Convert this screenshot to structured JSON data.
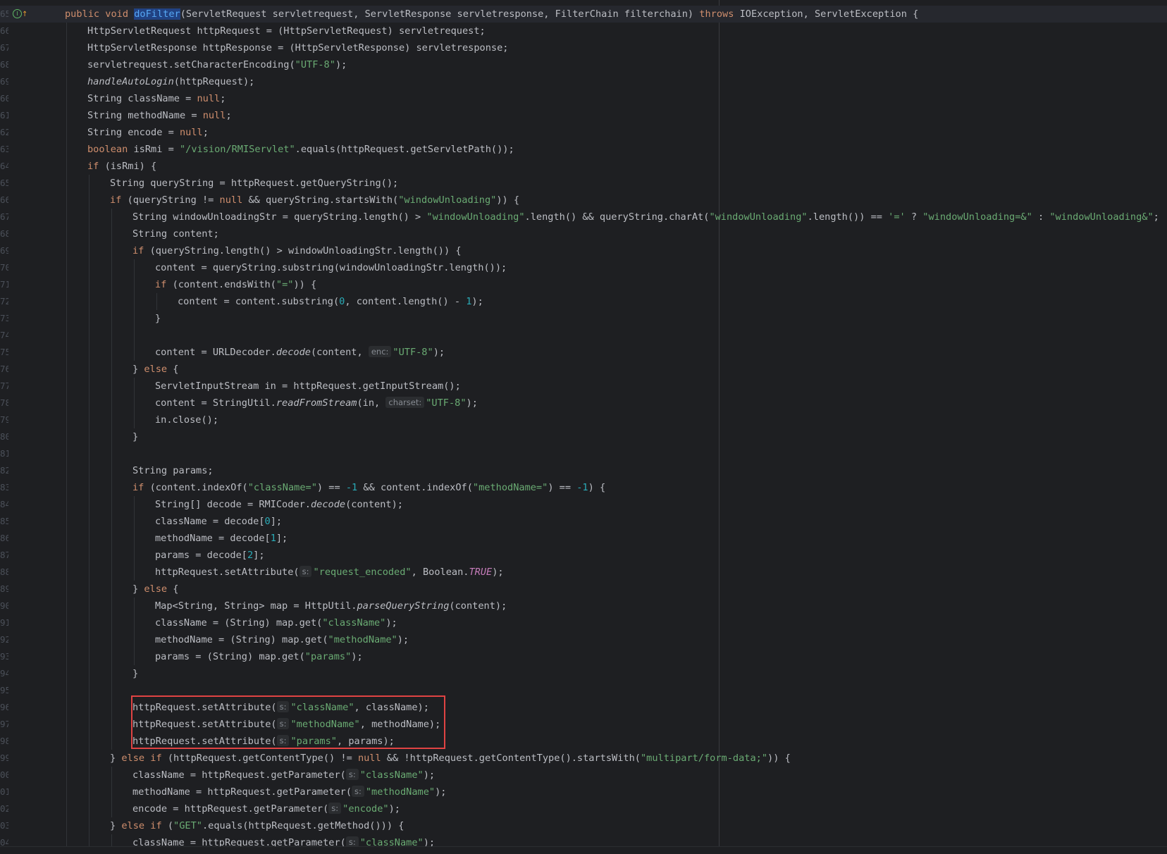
{
  "editor": {
    "annotation_icon": "implements-method-icon",
    "lines": [
      {
        "n": "65",
        "indent": 0,
        "current": true,
        "icon": true,
        "tokens": [
          [
            "kw",
            "public void "
          ],
          [
            "hl",
            "doFilter"
          ],
          [
            "p",
            "(ServletRequest servletrequest, ServletResponse servletresponse, FilterChain filterchain) "
          ],
          [
            "kw",
            "throws "
          ],
          [
            "p",
            "IOException, ServletException {"
          ]
        ]
      },
      {
        "n": "66",
        "indent": 1,
        "tokens": [
          [
            "p",
            "HttpServletRequest httpRequest = (HttpServletRequest) servletrequest;"
          ]
        ]
      },
      {
        "n": "67",
        "indent": 1,
        "tokens": [
          [
            "p",
            "HttpServletResponse httpResponse = (HttpServletResponse) servletresponse;"
          ]
        ]
      },
      {
        "n": "68",
        "indent": 1,
        "tokens": [
          [
            "p",
            "servletrequest.setCharacterEncoding("
          ],
          [
            "str",
            "\"UTF-8\""
          ],
          [
            "p",
            ");"
          ]
        ]
      },
      {
        "n": "69",
        "indent": 1,
        "tokens": [
          [
            "it",
            "handleAutoLogin"
          ],
          [
            "p",
            "(httpRequest);"
          ]
        ]
      },
      {
        "n": "60",
        "indent": 1,
        "tokens": [
          [
            "p",
            "String className = "
          ],
          [
            "kw",
            "null"
          ],
          [
            "p",
            ";"
          ]
        ]
      },
      {
        "n": "61",
        "indent": 1,
        "tokens": [
          [
            "p",
            "String methodName = "
          ],
          [
            "kw",
            "null"
          ],
          [
            "p",
            ";"
          ]
        ]
      },
      {
        "n": "62",
        "indent": 1,
        "tokens": [
          [
            "p",
            "String encode = "
          ],
          [
            "kw",
            "null"
          ],
          [
            "p",
            ";"
          ]
        ]
      },
      {
        "n": "63",
        "indent": 1,
        "tokens": [
          [
            "kw",
            "boolean "
          ],
          [
            "p",
            "isRmi = "
          ],
          [
            "str",
            "\"/vision/RMIServlet\""
          ],
          [
            "p",
            ".equals(httpRequest.getServletPath());"
          ]
        ]
      },
      {
        "n": "64",
        "indent": 1,
        "tokens": [
          [
            "kw",
            "if "
          ],
          [
            "p",
            "(isRmi) {"
          ]
        ]
      },
      {
        "n": "65",
        "indent": 2,
        "tokens": [
          [
            "p",
            "String queryString = httpRequest.getQueryString();"
          ]
        ]
      },
      {
        "n": "66",
        "indent": 2,
        "tokens": [
          [
            "kw",
            "if "
          ],
          [
            "p",
            "(queryString != "
          ],
          [
            "kw",
            "null "
          ],
          [
            "p",
            "&& queryString.startsWith("
          ],
          [
            "str",
            "\"windowUnloading\""
          ],
          [
            "p",
            ")) {"
          ]
        ]
      },
      {
        "n": "67",
        "indent": 3,
        "tokens": [
          [
            "p",
            "String windowUnloadingStr = queryString.length() > "
          ],
          [
            "str",
            "\"windowUnloading\""
          ],
          [
            "p",
            ".length() && queryString.charAt("
          ],
          [
            "str",
            "\"windowUnloading\""
          ],
          [
            "p",
            ".length()) == "
          ],
          [
            "str",
            "'='"
          ],
          [
            "p",
            " ? "
          ],
          [
            "str",
            "\"windowUnloading=&\""
          ],
          [
            "p",
            " : "
          ],
          [
            "str",
            "\"windowUnloading&\""
          ],
          [
            "p",
            ";"
          ]
        ]
      },
      {
        "n": "68",
        "indent": 3,
        "tokens": [
          [
            "p",
            "String content;"
          ]
        ]
      },
      {
        "n": "69",
        "indent": 3,
        "tokens": [
          [
            "kw",
            "if "
          ],
          [
            "p",
            "(queryString.length() > windowUnloadingStr.length()) {"
          ]
        ]
      },
      {
        "n": "70",
        "indent": 4,
        "tokens": [
          [
            "p",
            "content = queryString.substring(windowUnloadingStr.length());"
          ]
        ]
      },
      {
        "n": "71",
        "indent": 4,
        "tokens": [
          [
            "kw",
            "if "
          ],
          [
            "p",
            "(content.endsWith("
          ],
          [
            "str",
            "\"=\""
          ],
          [
            "p",
            ")) {"
          ]
        ]
      },
      {
        "n": "72",
        "indent": 5,
        "tokens": [
          [
            "p",
            "content = content.substring("
          ],
          [
            "num",
            "0"
          ],
          [
            "p",
            ", content.length() - "
          ],
          [
            "num",
            "1"
          ],
          [
            "p",
            ");"
          ]
        ]
      },
      {
        "n": "73",
        "indent": 4,
        "tokens": [
          [
            "p",
            "}"
          ]
        ]
      },
      {
        "n": "74",
        "indent": 4,
        "tokens": []
      },
      {
        "n": "75",
        "indent": 4,
        "tokens": [
          [
            "p",
            "content = URLDecoder."
          ],
          [
            "it",
            "decode"
          ],
          [
            "p",
            "(content, "
          ],
          [
            "hint",
            "enc:"
          ],
          [
            "str",
            "\"UTF-8\""
          ],
          [
            "p",
            ");"
          ]
        ]
      },
      {
        "n": "76",
        "indent": 3,
        "tokens": [
          [
            "p",
            "} "
          ],
          [
            "kw",
            "else "
          ],
          [
            "p",
            "{"
          ]
        ]
      },
      {
        "n": "77",
        "indent": 4,
        "tokens": [
          [
            "p",
            "ServletInputStream in = httpRequest.getInputStream();"
          ]
        ]
      },
      {
        "n": "78",
        "indent": 4,
        "tokens": [
          [
            "p",
            "content = StringUtil."
          ],
          [
            "it",
            "readFromStream"
          ],
          [
            "p",
            "(in, "
          ],
          [
            "hint",
            "charset:"
          ],
          [
            "str",
            "\"UTF-8\""
          ],
          [
            "p",
            ");"
          ]
        ]
      },
      {
        "n": "79",
        "indent": 4,
        "tokens": [
          [
            "p",
            "in.close();"
          ]
        ]
      },
      {
        "n": "80",
        "indent": 3,
        "tokens": [
          [
            "p",
            "}"
          ]
        ]
      },
      {
        "n": "81",
        "indent": 3,
        "tokens": []
      },
      {
        "n": "82",
        "indent": 3,
        "tokens": [
          [
            "p",
            "String params;"
          ]
        ]
      },
      {
        "n": "83",
        "indent": 3,
        "tokens": [
          [
            "kw",
            "if "
          ],
          [
            "p",
            "(content.indexOf("
          ],
          [
            "str",
            "\"className=\""
          ],
          [
            "p",
            ") == "
          ],
          [
            "num",
            "-1"
          ],
          [
            "p",
            " && content.indexOf("
          ],
          [
            "str",
            "\"methodName=\""
          ],
          [
            "p",
            ") == "
          ],
          [
            "num",
            "-1"
          ],
          [
            "p",
            ") {"
          ]
        ]
      },
      {
        "n": "84",
        "indent": 4,
        "tokens": [
          [
            "p",
            "String[] decode = RMICoder."
          ],
          [
            "it",
            "decode"
          ],
          [
            "p",
            "(content);"
          ]
        ]
      },
      {
        "n": "85",
        "indent": 4,
        "tokens": [
          [
            "p",
            "className = decode["
          ],
          [
            "num",
            "0"
          ],
          [
            "p",
            "];"
          ]
        ]
      },
      {
        "n": "86",
        "indent": 4,
        "tokens": [
          [
            "p",
            "methodName = decode["
          ],
          [
            "num",
            "1"
          ],
          [
            "p",
            "];"
          ]
        ]
      },
      {
        "n": "87",
        "indent": 4,
        "tokens": [
          [
            "p",
            "params = decode["
          ],
          [
            "num",
            "2"
          ],
          [
            "p",
            "];"
          ]
        ]
      },
      {
        "n": "88",
        "indent": 4,
        "tokens": [
          [
            "p",
            "httpRequest.setAttribute("
          ],
          [
            "hint",
            "s:"
          ],
          [
            "str",
            "\"request_encoded\""
          ],
          [
            "p",
            ", Boolean."
          ],
          [
            "const",
            "TRUE"
          ],
          [
            "p",
            ");"
          ]
        ]
      },
      {
        "n": "89",
        "indent": 3,
        "tokens": [
          [
            "p",
            "} "
          ],
          [
            "kw",
            "else "
          ],
          [
            "p",
            "{"
          ]
        ]
      },
      {
        "n": "90",
        "indent": 4,
        "tokens": [
          [
            "p",
            "Map<String, String> map = HttpUtil."
          ],
          [
            "it",
            "parseQueryString"
          ],
          [
            "p",
            "(content);"
          ]
        ]
      },
      {
        "n": "91",
        "indent": 4,
        "tokens": [
          [
            "p",
            "className = (String) map.get("
          ],
          [
            "str",
            "\"className\""
          ],
          [
            "p",
            ");"
          ]
        ]
      },
      {
        "n": "92",
        "indent": 4,
        "tokens": [
          [
            "p",
            "methodName = (String) map.get("
          ],
          [
            "str",
            "\"methodName\""
          ],
          [
            "p",
            ");"
          ]
        ]
      },
      {
        "n": "93",
        "indent": 4,
        "tokens": [
          [
            "p",
            "params = (String) map.get("
          ],
          [
            "str",
            "\"params\""
          ],
          [
            "p",
            ");"
          ]
        ]
      },
      {
        "n": "94",
        "indent": 3,
        "tokens": [
          [
            "p",
            "}"
          ]
        ]
      },
      {
        "n": "95",
        "indent": 3,
        "tokens": []
      },
      {
        "n": "96",
        "indent": 3,
        "tokens": [
          [
            "p",
            "httpRequest.setAttribute("
          ],
          [
            "hint",
            "s:"
          ],
          [
            "str",
            "\"className\""
          ],
          [
            "p",
            ", className);"
          ]
        ]
      },
      {
        "n": "97",
        "indent": 3,
        "tokens": [
          [
            "p",
            "httpRequest.setAttribute("
          ],
          [
            "hint",
            "s:"
          ],
          [
            "str",
            "\"methodName\""
          ],
          [
            "p",
            ", methodName);"
          ]
        ]
      },
      {
        "n": "98",
        "indent": 3,
        "tokens": [
          [
            "p",
            "httpRequest.setAttribute("
          ],
          [
            "hint",
            "s:"
          ],
          [
            "str",
            "\"params\""
          ],
          [
            "p",
            ", params);"
          ]
        ]
      },
      {
        "n": "99",
        "indent": 2,
        "tokens": [
          [
            "p",
            "} "
          ],
          [
            "kw",
            "else if "
          ],
          [
            "p",
            "(httpRequest.getContentType() != "
          ],
          [
            "kw",
            "null "
          ],
          [
            "p",
            "&& !httpRequest.getContentType().startsWith("
          ],
          [
            "str",
            "\"multipart/form-data;\""
          ],
          [
            "p",
            ")) {"
          ]
        ]
      },
      {
        "n": "00",
        "indent": 3,
        "tokens": [
          [
            "p",
            "className = httpRequest.getParameter("
          ],
          [
            "hint",
            "s:"
          ],
          [
            "str",
            "\"className\""
          ],
          [
            "p",
            ");"
          ]
        ]
      },
      {
        "n": "01",
        "indent": 3,
        "tokens": [
          [
            "p",
            "methodName = httpRequest.getParameter("
          ],
          [
            "hint",
            "s:"
          ],
          [
            "str",
            "\"methodName\""
          ],
          [
            "p",
            ");"
          ]
        ]
      },
      {
        "n": "02",
        "indent": 3,
        "tokens": [
          [
            "p",
            "encode = httpRequest.getParameter("
          ],
          [
            "hint",
            "s:"
          ],
          [
            "str",
            "\"encode\""
          ],
          [
            "p",
            ");"
          ]
        ]
      },
      {
        "n": "03",
        "indent": 2,
        "tokens": [
          [
            "p",
            "} "
          ],
          [
            "kw",
            "else if "
          ],
          [
            "p",
            "("
          ],
          [
            "str",
            "\"GET\""
          ],
          [
            "p",
            ".equals(httpRequest.getMethod())) {"
          ]
        ]
      },
      {
        "n": "04",
        "indent": 3,
        "tokens": [
          [
            "p",
            "className = httpRequest.getParameter("
          ],
          [
            "hint",
            "s:"
          ],
          [
            "str",
            "\"className\""
          ],
          [
            "p",
            ");"
          ]
        ]
      }
    ]
  },
  "colors": {
    "background": "#1e1f22",
    "keyword": "#cf8e6d",
    "string": "#6aab73",
    "number": "#2aacb8",
    "highlight_box": "#e04343"
  }
}
